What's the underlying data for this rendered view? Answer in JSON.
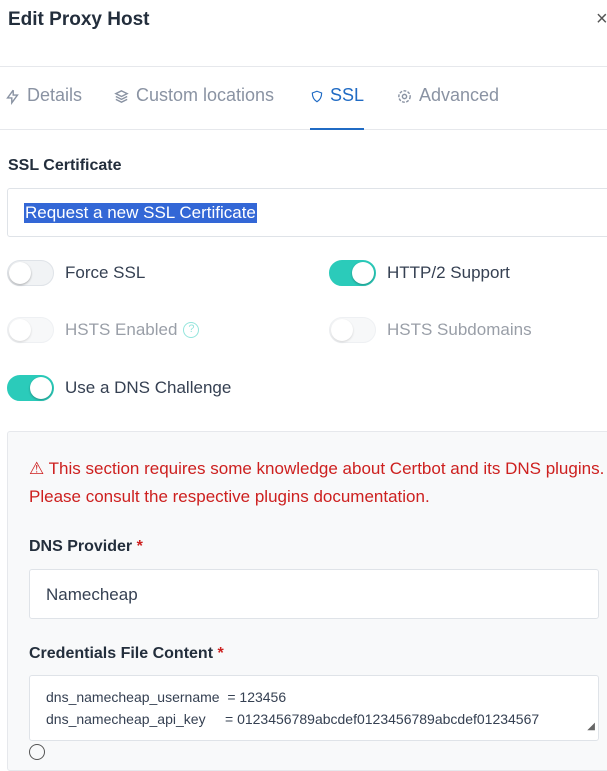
{
  "dialog": {
    "title": "Edit Proxy Host",
    "close": "×"
  },
  "tabs": [
    {
      "label": "Details",
      "icon": "bolt-icon"
    },
    {
      "label": "Custom locations",
      "icon": "layers-icon"
    },
    {
      "label": "SSL",
      "icon": "shield-icon",
      "active": true
    },
    {
      "label": "Advanced",
      "icon": "gear-icon"
    }
  ],
  "ssl": {
    "certificate_label": "SSL Certificate",
    "certificate_value": "Request a new SSL Certificate",
    "force_ssl": {
      "label": "Force SSL",
      "on": false
    },
    "http2": {
      "label": "HTTP/2 Support",
      "on": true
    },
    "hsts": {
      "label": "HSTS Enabled",
      "on": false,
      "help": "?"
    },
    "hsts_sub": {
      "label": "HSTS Subdomains",
      "on": false
    },
    "dns_challenge": {
      "label": "Use a DNS Challenge",
      "on": true
    },
    "warning": "This section requires some knowledge about Certbot and its DNS plugins. Please consult the respective plugins documentation.",
    "warning_icon": "⚠",
    "dns_provider_label": "DNS Provider",
    "required": "*",
    "dns_provider_value": "Namecheap",
    "credentials_label": "Credentials File Content",
    "credentials_value": "dns_namecheap_username  = 123456\ndns_namecheap_api_key     = 0123456789abcdef0123456789abcdef01234567"
  },
  "colors": {
    "accent": "#206bc4",
    "toggle_on": "#2bcbba",
    "danger": "#cd201f"
  }
}
